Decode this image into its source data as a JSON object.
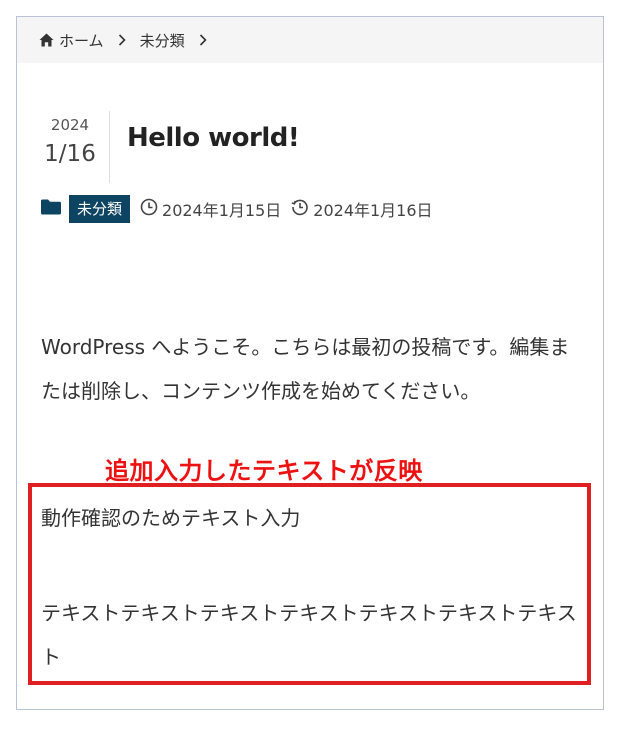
{
  "breadcrumb": {
    "home_label": "ホーム",
    "category_label": "未分類"
  },
  "post": {
    "date_year": "2024",
    "date_month_day": "1/16",
    "title": "Hello world!",
    "category": "未分類",
    "published_date": "2024年1月15日",
    "updated_date": "2024年1月16日",
    "intro_text": "WordPress へようこそ。こちらは最初の投稿です。編集または削除し、コンテンツ作成を始めてください。",
    "added_paragraph_1": "動作確認のためテキスト入力",
    "added_paragraph_2": "テキストテキストテキストテキストテキストテキストテキスト"
  },
  "annotation": {
    "text": "追加入力したテキストが反映"
  },
  "colors": {
    "badge_bg": "#0d4462",
    "annotation_red": "#ee1111",
    "highlight_border": "#e02020",
    "breadcrumb_bg": "#f5f5f5"
  }
}
